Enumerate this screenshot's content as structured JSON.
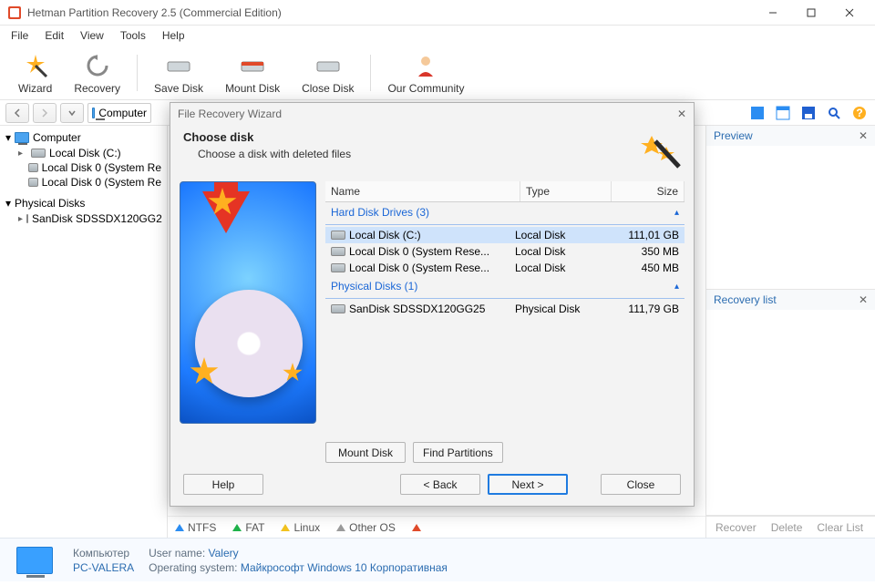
{
  "window": {
    "title": "Hetman Partition Recovery 2.5 (Commercial Edition)"
  },
  "menubar": [
    "File",
    "Edit",
    "View",
    "Tools",
    "Help"
  ],
  "toolbar": [
    "Wizard",
    "Recovery",
    "Save Disk",
    "Mount Disk",
    "Close Disk",
    "Our Community"
  ],
  "address": "Computer",
  "tree": {
    "group1": "Computer",
    "items1": [
      "Local Disk (C:)",
      "Local Disk 0 (System Re",
      "Local Disk 0 (System Re"
    ],
    "group2": "Physical Disks",
    "items2": [
      "SanDisk SDSSDX120GG2"
    ]
  },
  "preview": {
    "title": "Preview"
  },
  "recovery_list": {
    "title": "Recovery list"
  },
  "legend": [
    "NTFS",
    "FAT",
    "Linux",
    "Other OS"
  ],
  "legend_colors": [
    "#2b8df2",
    "#1fb24a",
    "#f2c21f",
    "#9b9b9b"
  ],
  "footer_actions": [
    "Recover",
    "Delete",
    "Clear List"
  ],
  "status": {
    "computer_lbl": "Компьютер",
    "pcname": "PC-VALERA",
    "user_lbl": "User name:",
    "user_val": "Valery",
    "os_lbl": "Operating system:",
    "os_val": "Майкрософт Windows 10 Корпоративная"
  },
  "dialog": {
    "title": "File Recovery Wizard",
    "heading": "Choose disk",
    "sub": "Choose a disk with deleted files",
    "cols": [
      "Name",
      "Type",
      "Size"
    ],
    "group_hdd": "Hard Disk Drives (3)",
    "rows_hdd": [
      {
        "name": "Local Disk (C:)",
        "type": "Local Disk",
        "size": "111,01 GB",
        "selected": true
      },
      {
        "name": "Local Disk 0 (System Rese...",
        "type": "Local Disk",
        "size": "350 MB"
      },
      {
        "name": "Local Disk 0 (System Rese...",
        "type": "Local Disk",
        "size": "450 MB"
      }
    ],
    "group_phys": "Physical Disks (1)",
    "rows_phys": [
      {
        "name": "SanDisk SDSSDX120GG25",
        "type": "Physical Disk",
        "size": "111,79 GB"
      }
    ],
    "btn_mount": "Mount Disk",
    "btn_find": "Find Partitions",
    "btn_help": "Help",
    "btn_back": "< Back",
    "btn_next": "Next >",
    "btn_close": "Close"
  }
}
